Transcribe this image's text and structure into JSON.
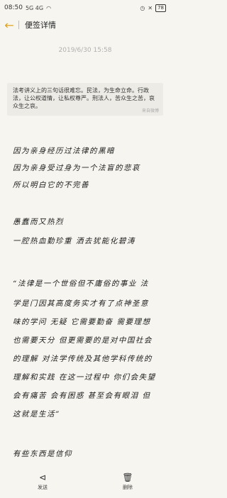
{
  "status_bar": {
    "time": "08:50",
    "indicators": "5G 4G",
    "battery": "78"
  },
  "header": {
    "back_icon": "chevron-left-icon",
    "title": "便签详情"
  },
  "note": {
    "date": "2019/6/30 15:58",
    "quote_card": {
      "text": "法考讲义上的三句话很难忘。民法，为生命立命。行政法，让公权道情，让私权尊严。刑法人，苦众生之苦，哀众生之哀。",
      "source": "来自微博"
    },
    "lines": [
      "因为亲身经历过法律的黑暗",
      "因为亲身受过身为一个法盲的悲哀",
      "所以明白它的不完善",
      "愚蠢而又热烈",
      "一腔热血勤珍重 洒去犹能化碧涛",
      "“法律是一个世俗但不庸俗的事业 法",
      "学是门因其高度务实才有了点神圣意",
      "味的学问 无疑 它需要勤奋 需要理想",
      "也需要天分 但更需要的是对中国社会",
      "的理解 对法学传统及其他学科传统的",
      "理解和实践 在这一过程中 你们会失望",
      "会有痛苦 会有困惑 甚至会有眼泪 但",
      "这就是生活”",
      "有些东西是信仰"
    ]
  },
  "bottom_bar": {
    "share_label": "发送",
    "delete_label": "删除"
  }
}
